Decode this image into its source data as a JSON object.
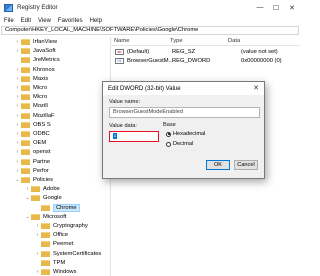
{
  "window": {
    "title": "Registry Editor",
    "minimize": "—",
    "maximize": "☐",
    "close": "✕"
  },
  "menu": [
    "File",
    "Edit",
    "View",
    "Favorites",
    "Help"
  ],
  "address": "Computer\\HKEY_LOCAL_MACHINE\\SOFTWARE\\Policies\\Google\\Chrome",
  "tree": [
    {
      "label": "IrfanView",
      "indent": 1,
      "expand": "›"
    },
    {
      "label": "JavaSoft",
      "indent": 1,
      "expand": "›"
    },
    {
      "label": "JreMetrics",
      "indent": 1,
      "expand": ""
    },
    {
      "label": "Khronos",
      "indent": 1,
      "expand": "›"
    },
    {
      "label": "Maxis",
      "indent": 1,
      "expand": "›"
    },
    {
      "label": "Micro",
      "indent": 1,
      "expand": "›"
    },
    {
      "label": "Micro",
      "indent": 1,
      "expand": "›"
    },
    {
      "label": "Mozill",
      "indent": 1,
      "expand": "›"
    },
    {
      "label": "MozillaF",
      "indent": 1,
      "expand": "›"
    },
    {
      "label": "OBS S",
      "indent": 1,
      "expand": "›"
    },
    {
      "label": "ODBC",
      "indent": 1,
      "expand": "›"
    },
    {
      "label": "OEM",
      "indent": 1,
      "expand": "›"
    },
    {
      "label": "openst",
      "indent": 1,
      "expand": "›"
    },
    {
      "label": "Partne",
      "indent": 1,
      "expand": "›"
    },
    {
      "label": "Perfor",
      "indent": 1,
      "expand": "›"
    },
    {
      "label": "Policies",
      "indent": 1,
      "expand": "⌄"
    },
    {
      "label": "Adobe",
      "indent": 2,
      "expand": "›"
    },
    {
      "label": "Google",
      "indent": 2,
      "expand": "⌄"
    },
    {
      "label": "Chrome",
      "indent": 3,
      "expand": "",
      "selected": true
    },
    {
      "label": "Microsoft",
      "indent": 2,
      "expand": "⌄"
    },
    {
      "label": "Cryptography",
      "indent": 3,
      "expand": "›"
    },
    {
      "label": "Office",
      "indent": 3,
      "expand": "›"
    },
    {
      "label": "Peernet",
      "indent": 3,
      "expand": ""
    },
    {
      "label": "SystemCertificates",
      "indent": 3,
      "expand": "›"
    },
    {
      "label": "TPM",
      "indent": 3,
      "expand": ""
    },
    {
      "label": "Windows",
      "indent": 3,
      "expand": "›"
    }
  ],
  "list": {
    "headers": [
      "Name",
      "Type",
      "Data"
    ],
    "rows": [
      {
        "icon": "ab",
        "name": "(Default)",
        "type": "REG_SZ",
        "data": "(value not set)"
      },
      {
        "icon": "01",
        "name": "BrowserGuestM...",
        "type": "REG_DWORD",
        "data": "0x00000000 (0)"
      }
    ]
  },
  "dialog": {
    "title": "Edit DWORD (32-bit) Value",
    "close": "✕",
    "value_name_label": "Value name:",
    "value_name": "BrowserGuestModeEnabled",
    "value_data_label": "Value data:",
    "value_data": "1",
    "base_label": "Base",
    "radio_hex": "Hexadecimal",
    "radio_dec": "Decimal",
    "ok": "OK",
    "cancel": "Cancel"
  }
}
